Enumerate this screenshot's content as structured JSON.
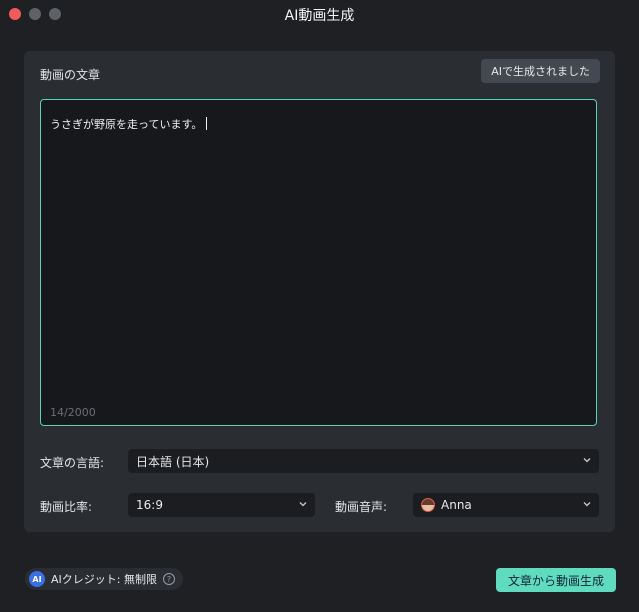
{
  "window": {
    "title": "AI動画生成"
  },
  "panel": {
    "label": "動画の文章",
    "ai_badge": "AIで生成されました",
    "editor_text": "うさぎが野原を走っています。",
    "counter": "14/2000"
  },
  "language": {
    "label": "文章の言語:",
    "value": "日本語 (日本)"
  },
  "aspect": {
    "label": "動画比率:",
    "value": "16:9"
  },
  "voice": {
    "label": "動画音声:",
    "value": "Anna"
  },
  "footer": {
    "credit_icon_text": "AI",
    "credit_text": "AIクレジット: 無制限",
    "help_glyph": "?",
    "generate_button": "文章から動画生成"
  },
  "colors": {
    "accent": "#5fdcc0",
    "editor_border": "#58d3b8",
    "close_dot": "#f05b5b"
  }
}
